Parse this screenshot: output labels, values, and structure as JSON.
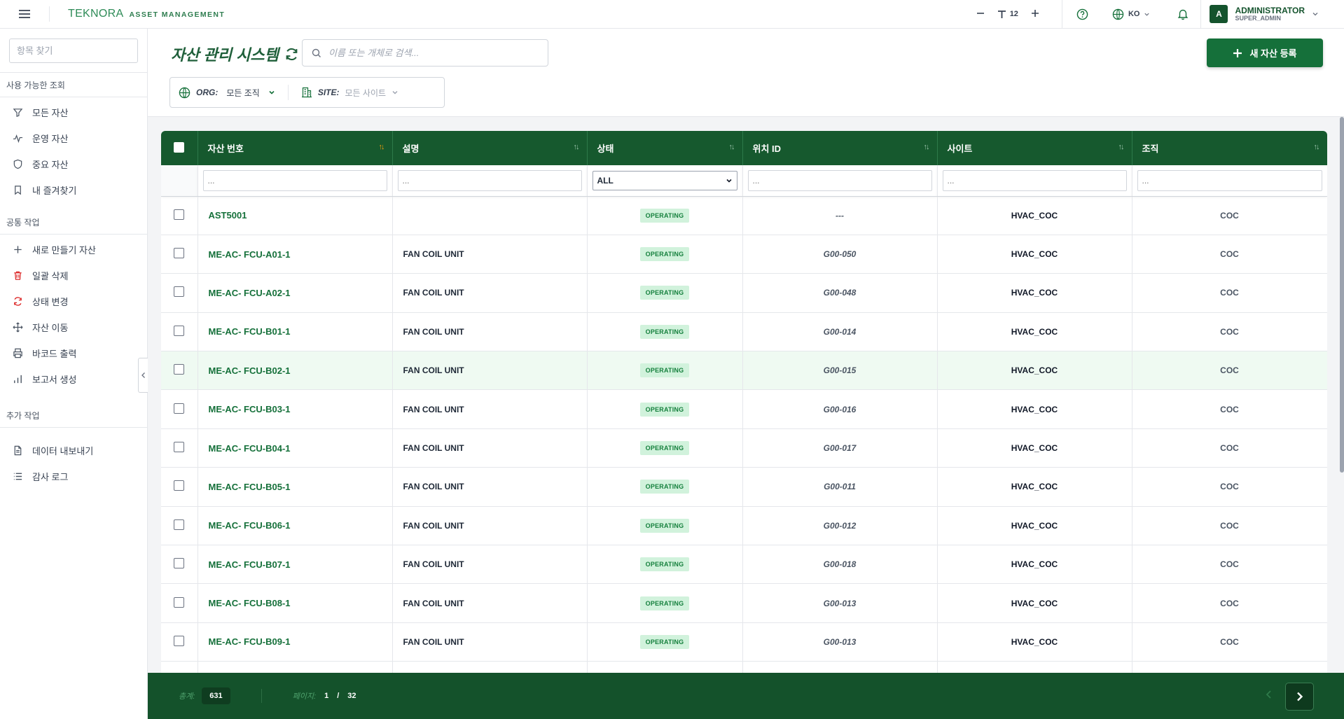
{
  "topbar": {
    "brand_logo": "TEKNORA",
    "brand_sub": "ASSET MANAGEMENT",
    "font_size": "12",
    "language": "KO",
    "user_initial": "A",
    "user_name": "ADMINISTRATOR",
    "user_role": "SUPER_ADMIN"
  },
  "sidebar": {
    "search_placeholder": "항목 찾기",
    "sections": [
      {
        "title": "사용 가능한 조회",
        "items": [
          {
            "label": "모든 자산",
            "icon": "filter-icon"
          },
          {
            "label": "운영 자산",
            "icon": "activity-icon"
          },
          {
            "label": "중요 자산",
            "icon": "shield-icon"
          },
          {
            "label": "내 즐겨찾기",
            "icon": "bookmark-icon"
          }
        ]
      },
      {
        "title": "공통 작업",
        "items": [
          {
            "label": "새로 만들기 자산",
            "icon": "plus-icon"
          },
          {
            "label": "일괄 삭제",
            "icon": "trash-icon"
          },
          {
            "label": "상태 변경",
            "icon": "refresh-icon"
          },
          {
            "label": "자산 이동",
            "icon": "move-icon"
          },
          {
            "label": "바코드 출력",
            "icon": "printer-icon"
          },
          {
            "label": "보고서 생성",
            "icon": "bar-chart-icon"
          }
        ]
      },
      {
        "title": "추가 작업",
        "items": [
          {
            "label": "데이터 내보내기",
            "icon": "file-icon"
          },
          {
            "label": "감사 로그",
            "icon": "list-icon"
          }
        ]
      }
    ]
  },
  "header": {
    "title": "자산 관리 시스템",
    "search_placeholder": "이름 또는 개체로 검색...",
    "new_button": "새 자산 등록",
    "org_label": "ORG:",
    "org_value": "모든 조직",
    "site_label": "SITE:",
    "site_value": "모든 사이트"
  },
  "table": {
    "columns": [
      "자산 번호",
      "설명",
      "상태",
      "위치 ID",
      "사이트",
      "조직"
    ],
    "filter_placeholder": "...",
    "status_filter": "ALL",
    "rows": [
      {
        "asset": "AST5001",
        "desc": "",
        "status": "OPERATING",
        "loc": "---",
        "site": "HVAC_COC",
        "org": "COC"
      },
      {
        "asset": "ME-AC- FCU-A01-1",
        "desc": "FAN COIL UNIT",
        "status": "OPERATING",
        "loc": "G00-050",
        "site": "HVAC_COC",
        "org": "COC"
      },
      {
        "asset": "ME-AC- FCU-A02-1",
        "desc": "FAN COIL UNIT",
        "status": "OPERATING",
        "loc": "G00-048",
        "site": "HVAC_COC",
        "org": "COC"
      },
      {
        "asset": "ME-AC- FCU-B01-1",
        "desc": "FAN COIL UNIT",
        "status": "OPERATING",
        "loc": "G00-014",
        "site": "HVAC_COC",
        "org": "COC"
      },
      {
        "asset": "ME-AC- FCU-B02-1",
        "desc": "FAN COIL UNIT",
        "status": "OPERATING",
        "loc": "G00-015",
        "site": "HVAC_COC",
        "org": "COC"
      },
      {
        "asset": "ME-AC- FCU-B03-1",
        "desc": "FAN COIL UNIT",
        "status": "OPERATING",
        "loc": "G00-016",
        "site": "HVAC_COC",
        "org": "COC"
      },
      {
        "asset": "ME-AC- FCU-B04-1",
        "desc": "FAN COIL UNIT",
        "status": "OPERATING",
        "loc": "G00-017",
        "site": "HVAC_COC",
        "org": "COC"
      },
      {
        "asset": "ME-AC- FCU-B05-1",
        "desc": "FAN COIL UNIT",
        "status": "OPERATING",
        "loc": "G00-011",
        "site": "HVAC_COC",
        "org": "COC"
      },
      {
        "asset": "ME-AC- FCU-B06-1",
        "desc": "FAN COIL UNIT",
        "status": "OPERATING",
        "loc": "G00-012",
        "site": "HVAC_COC",
        "org": "COC"
      },
      {
        "asset": "ME-AC- FCU-B07-1",
        "desc": "FAN COIL UNIT",
        "status": "OPERATING",
        "loc": "G00-018",
        "site": "HVAC_COC",
        "org": "COC"
      },
      {
        "asset": "ME-AC- FCU-B08-1",
        "desc": "FAN COIL UNIT",
        "status": "OPERATING",
        "loc": "G00-013",
        "site": "HVAC_COC",
        "org": "COC"
      },
      {
        "asset": "ME-AC- FCU-B09-1",
        "desc": "FAN COIL UNIT",
        "status": "OPERATING",
        "loc": "G00-013",
        "site": "HVAC_COC",
        "org": "COC"
      }
    ]
  },
  "footer": {
    "total_label": "총계:",
    "total": "631",
    "page_label": "페이지:",
    "page_current": "1",
    "page_sep": "/",
    "page_total": "32"
  }
}
